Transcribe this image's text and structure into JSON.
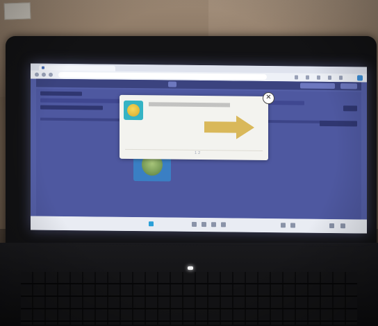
{
  "scene": {
    "subject": "laptop-showing-browser-popup",
    "colors": {
      "wall": "#8a7663",
      "bezel": "#121214",
      "page_background": "#5560a8",
      "popup_background": "#f3f3ef",
      "popup_badge": "#35b3c4",
      "arrow": "#d9b85a"
    }
  },
  "browser": {
    "tab_title": "",
    "address": ""
  },
  "popup": {
    "title": "",
    "arrow_label": "",
    "pager": "1  2",
    "close_label": "✕",
    "badge_icon": "coin-icon",
    "close_icon": "close-icon",
    "arrow_icon": "arrow-right-icon"
  },
  "taskbar": {
    "icons": [
      "windows-icon",
      "search-icon",
      "folder-icon",
      "edge-icon",
      "store-icon",
      "wifi-icon",
      "volume-icon",
      "battery-icon"
    ]
  }
}
